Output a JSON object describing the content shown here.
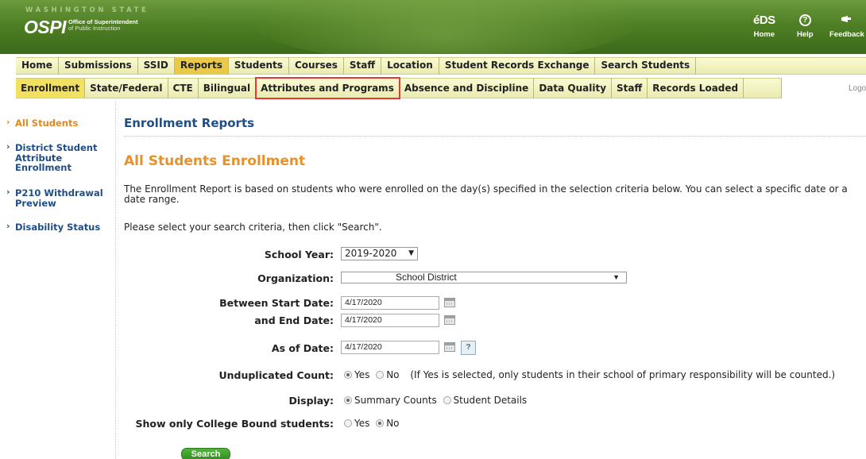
{
  "header": {
    "logo_tagline": "WASHINGTON STATE",
    "logo_name": "OSPI",
    "logo_sub1": "Office of Superintendent",
    "logo_sub2": "of Public Instruction",
    "tools": [
      {
        "icon": "eds-logo-icon",
        "glyph": "éDS",
        "label": "Home"
      },
      {
        "icon": "help-icon",
        "glyph": "?",
        "label": "Help"
      },
      {
        "icon": "feedback-icon",
        "glyph": "",
        "label": "Feedback"
      }
    ]
  },
  "nav_primary": [
    "Home",
    "Submissions",
    "SSID",
    "Reports",
    "Students",
    "Courses",
    "Staff",
    "Location",
    "Student Records Exchange",
    "Search Students"
  ],
  "nav_primary_active": "Reports",
  "nav_secondary": [
    "Enrollment",
    "State/Federal",
    "CTE",
    "Bilingual",
    "Attributes and Programs",
    "Absence and Discipline",
    "Data Quality",
    "Staff",
    "Records Loaded"
  ],
  "nav_secondary_active": "Enrollment",
  "nav_secondary_highlighted": "Attributes and Programs",
  "logout_label": "Logout",
  "sidebar": {
    "items": [
      {
        "label": "All Students",
        "active": true
      },
      {
        "label": "District Student Attribute Enrollment",
        "active": false
      },
      {
        "label": "P210 Withdrawal Preview",
        "active": false
      },
      {
        "label": "Disability Status",
        "active": false
      }
    ]
  },
  "main": {
    "title": "Enrollment Reports",
    "subtitle": "All Students Enrollment",
    "intro": "The Enrollment Report is based on students who were enrolled on the day(s) specified in the selection criteria below. You can select a specific date or a date range.",
    "instructions": "Please select your search criteria, then click \"Search\".",
    "form": {
      "school_year_label": "School Year:",
      "school_year_value": "2019-2020",
      "organization_label": "Organization:",
      "organization_value": "School District",
      "start_date_label": "Between Start Date:",
      "start_date_value": "4/17/2020",
      "end_date_label": "and End Date:",
      "end_date_value": "4/17/2020",
      "as_of_label": "As of Date:",
      "as_of_value": "4/17/2020",
      "help_glyph": "?",
      "unduplicated_label": "Unduplicated Count:",
      "unduplicated_options": [
        "Yes",
        "No"
      ],
      "unduplicated_selected": "Yes",
      "unduplicated_note": "(If Yes is selected, only students in their school of primary responsibility will be counted.)",
      "display_label": "Display:",
      "display_options": [
        "Summary Counts",
        "Student Details"
      ],
      "display_selected": "Summary Counts",
      "college_label": "Show only College Bound students:",
      "college_options": [
        "Yes",
        "No"
      ],
      "college_selected": "No",
      "search_button": "Search"
    }
  }
}
